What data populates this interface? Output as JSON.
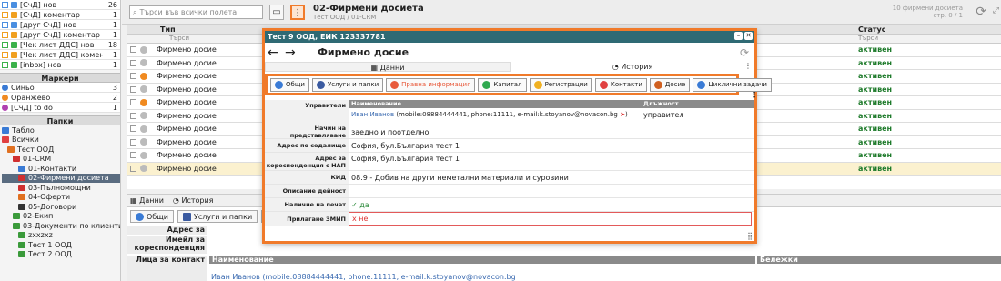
{
  "sidebar": {
    "tags": [
      {
        "label": "[СчД] нов",
        "count": "26",
        "color": "#4a8ee0"
      },
      {
        "label": "[СчД] коментар",
        "count": "1",
        "color": "#f0a020"
      },
      {
        "label": "[друг СчД] нов",
        "count": "1",
        "color": "#4a8ee0"
      },
      {
        "label": "[друг СчД] коментар",
        "count": "1",
        "color": "#f0a020"
      },
      {
        "label": "[Чек лист ДДС] нов",
        "count": "18",
        "color": "#3bb14a"
      },
      {
        "label": "[Чек лист ДДС] коментар",
        "count": "1",
        "color": "#f0a020"
      },
      {
        "label": "[inbox] нов",
        "count": "1",
        "color": "#3bb14a"
      }
    ],
    "markers_title": "Маркери",
    "markers": [
      {
        "label": "Синьо",
        "count": "3",
        "color": "#3a7bd5"
      },
      {
        "label": "Оранжево",
        "count": "2",
        "color": "#f08a20"
      },
      {
        "label": "[СчД] to do",
        "count": "1",
        "color": "#b040b0"
      }
    ],
    "folders_title": "Папки",
    "tree": [
      {
        "label": "Табло",
        "indent": 0,
        "color": "#3a7bd5"
      },
      {
        "label": "Всички",
        "indent": 0,
        "color": "#e04040"
      },
      {
        "label": "Тест ООД",
        "indent": 1,
        "color": "#e07020"
      },
      {
        "label": "01-CRM",
        "indent": 2,
        "color": "#d03030"
      },
      {
        "label": "01-Контакти",
        "indent": 3,
        "color": "#3a7bd5"
      },
      {
        "label": "02-Фирмени досиета",
        "indent": 3,
        "color": "#d03030"
      },
      {
        "label": "03-Пълномощни",
        "indent": 3,
        "color": "#d03030"
      },
      {
        "label": "04-Оферти",
        "indent": 3,
        "color": "#e07020"
      },
      {
        "label": "05-Договори",
        "indent": 3,
        "color": "#333"
      },
      {
        "label": "02-Екип",
        "indent": 2,
        "color": "#3a9a3a"
      },
      {
        "label": "03-Документи по клиенти",
        "indent": 2,
        "color": "#3a9a3a"
      },
      {
        "label": "zxxzxz",
        "indent": 3,
        "color": "#3a9a3a"
      },
      {
        "label": "Тест 1 ООД",
        "indent": 3,
        "color": "#3a9a3a"
      },
      {
        "label": "Тест 2 ООД",
        "indent": 3,
        "color": "#3a9a3a"
      }
    ]
  },
  "topbar": {
    "search_placeholder": "Търси във всички полета",
    "title": "02-Фирмени досиета",
    "subtitle": "Тест ООД / 01-CRM",
    "count_line1": "10 фирмени досиета",
    "count_line2": "стр. 0 / 1"
  },
  "grid": {
    "col_type": "Тип",
    "col_status": "Статус",
    "filter_placeholder": "Търси",
    "rows": [
      {
        "type": "Фирмено досие",
        "status": "активен",
        "dot": "#bbb",
        "highlight": false
      },
      {
        "type": "Фирмено досие",
        "status": "активен",
        "dot": "#bbb",
        "highlight": false
      },
      {
        "type": "Фирмено досие",
        "status": "активен",
        "dot": "#f08a20",
        "highlight": false
      },
      {
        "type": "Фирмено досие",
        "status": "активен",
        "dot": "#bbb",
        "highlight": false
      },
      {
        "type": "Фирмено досие",
        "status": "активен",
        "dot": "#f08a20",
        "highlight": false
      },
      {
        "type": "Фирмено досие",
        "status": "активен",
        "dot": "#bbb",
        "highlight": false
      },
      {
        "type": "Фирмено досие",
        "status": "активен",
        "dot": "#bbb",
        "highlight": false
      },
      {
        "type": "Фирмено досие",
        "status": "активен",
        "dot": "#bbb",
        "highlight": false
      },
      {
        "type": "Фирмено досие",
        "status": "активен",
        "dot": "#bbb",
        "highlight": false
      },
      {
        "type": "Фирмено досие",
        "status": "активен",
        "dot": "#bbb",
        "highlight": true
      }
    ]
  },
  "bottom": {
    "tab_data": "Данни",
    "tab_history": "История",
    "btn_general": "Общи",
    "btn_services": "Услуги и папки",
    "lbl_address": "Адрес за кореспонденция",
    "lbl_email": "Имейл за кореспонденция",
    "lbl_contact": "Лица за контакт",
    "contact_head": "Наименование",
    "notes_head": "Бележки",
    "contact_value": "Иван Иванов (mobile:08884444441, phone:11111, e-mail:k.stoyanov@novacon.bg"
  },
  "modal": {
    "header": "Тест 9 ООД, ЕИК 123337781",
    "title": "Фирмено досие",
    "tab_data": "Данни",
    "tab_history": "История",
    "buttons": [
      {
        "label": "Общи",
        "color": "#3a7bd5"
      },
      {
        "label": "Услуги и папки",
        "color": "#3a5aa0"
      },
      {
        "label": "Правна информация",
        "color": "#e85a3b",
        "red": true
      },
      {
        "label": "Капитал",
        "color": "#2fa84f"
      },
      {
        "label": "Регистрации",
        "color": "#f0b020"
      },
      {
        "label": "Контакти",
        "color": "#e04040"
      },
      {
        "label": "Досие",
        "color": "#d06020"
      },
      {
        "label": "Циклични задачи",
        "color": "#3a7bd5"
      }
    ],
    "managers_label": "Управители",
    "col_name": "Наименование",
    "col_role": "Длъжност",
    "manager_name": "Иван Иванов",
    "manager_info": " (mobile:08884444441, phone:11111, e-mail:k.stoyanov@novacon.bg",
    "manager_role": "управител",
    "representation_label": "Начин на представляване",
    "representation": "заедно и поотделно",
    "address_label": "Адрес по седалище",
    "address": "София, бул.България тест 1",
    "nap_label": "Адрес за кореспонденция с НАП",
    "nap": "София, бул.България тест 1",
    "kid_label": "КИД",
    "kid": "08.9 - Добив на други неметални материали и суровини",
    "activity_label": "Описание дейност",
    "activity": "",
    "stamp_label": "Наличие на печат",
    "stamp": "✓ да",
    "zmip_label": "Прилагане ЗМИП",
    "zmip": "х не"
  }
}
